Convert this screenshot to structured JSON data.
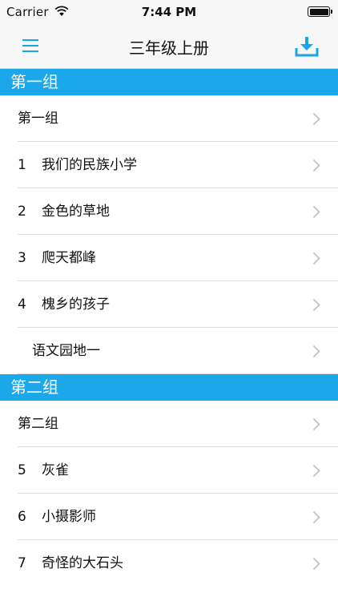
{
  "status": {
    "carrier": "Carrier",
    "time": "7:44 PM"
  },
  "nav": {
    "title": "三年级上册",
    "menu_icon": "hamburger-menu-icon",
    "download_icon": "download-icon"
  },
  "accent_color": "#1ba8ea",
  "sections": [
    {
      "title": "第一组",
      "rows": [
        {
          "num": "",
          "text": "第一组"
        },
        {
          "num": "1",
          "text": "我们的民族小学"
        },
        {
          "num": "2",
          "text": "金色的草地"
        },
        {
          "num": "3",
          "text": "爬天都峰"
        },
        {
          "num": "4",
          "text": "槐乡的孩子"
        },
        {
          "num": "",
          "text": "语文园地一"
        }
      ]
    },
    {
      "title": "第二组",
      "rows": [
        {
          "num": "",
          "text": "第二组"
        },
        {
          "num": "5",
          "text": "灰雀"
        },
        {
          "num": "6",
          "text": "小摄影师"
        },
        {
          "num": "7",
          "text": "奇怪的大石头"
        }
      ]
    }
  ]
}
